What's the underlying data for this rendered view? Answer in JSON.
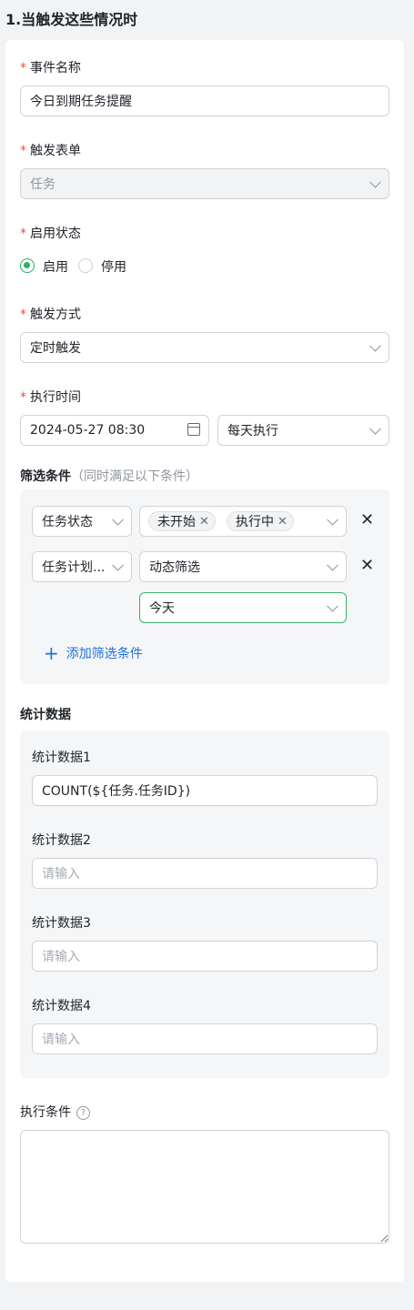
{
  "section_title": "1.当触发这些情况时",
  "required_mark": "*",
  "event_name": {
    "label": "事件名称",
    "value": "今日到期任务提醒"
  },
  "trigger_form": {
    "label": "触发表单",
    "value": "任务"
  },
  "status": {
    "label": "启用状态",
    "options": [
      "启用",
      "停用"
    ],
    "selected": "启用"
  },
  "trigger_mode": {
    "label": "触发方式",
    "value": "定时触发"
  },
  "exec_time": {
    "label": "执行时间",
    "datetime": "2024-05-27 08:30",
    "repeat": "每天执行"
  },
  "filter": {
    "label": "筛选条件",
    "hint": "（同时满足以下条件）",
    "rows": [
      {
        "field": "任务状态",
        "tags": [
          "未开始",
          "执行中"
        ]
      },
      {
        "field": "任务计划...",
        "op": "动态筛选",
        "value": "今天"
      }
    ],
    "add_label": "添加筛选条件",
    "add_icon": "+"
  },
  "stats": {
    "label": "统计数据",
    "items": [
      {
        "label": "统计数据1",
        "value": "COUNT(${任务.任务ID})"
      },
      {
        "label": "统计数据2",
        "placeholder": "请输入"
      },
      {
        "label": "统计数据3",
        "placeholder": "请输入"
      },
      {
        "label": "统计数据4",
        "placeholder": "请输入"
      }
    ]
  },
  "exec_condition": {
    "label": "执行条件",
    "help_icon": "?"
  },
  "colors": {
    "required": "#f54a45",
    "accent": "#22b35e",
    "link": "#1f6fde"
  }
}
